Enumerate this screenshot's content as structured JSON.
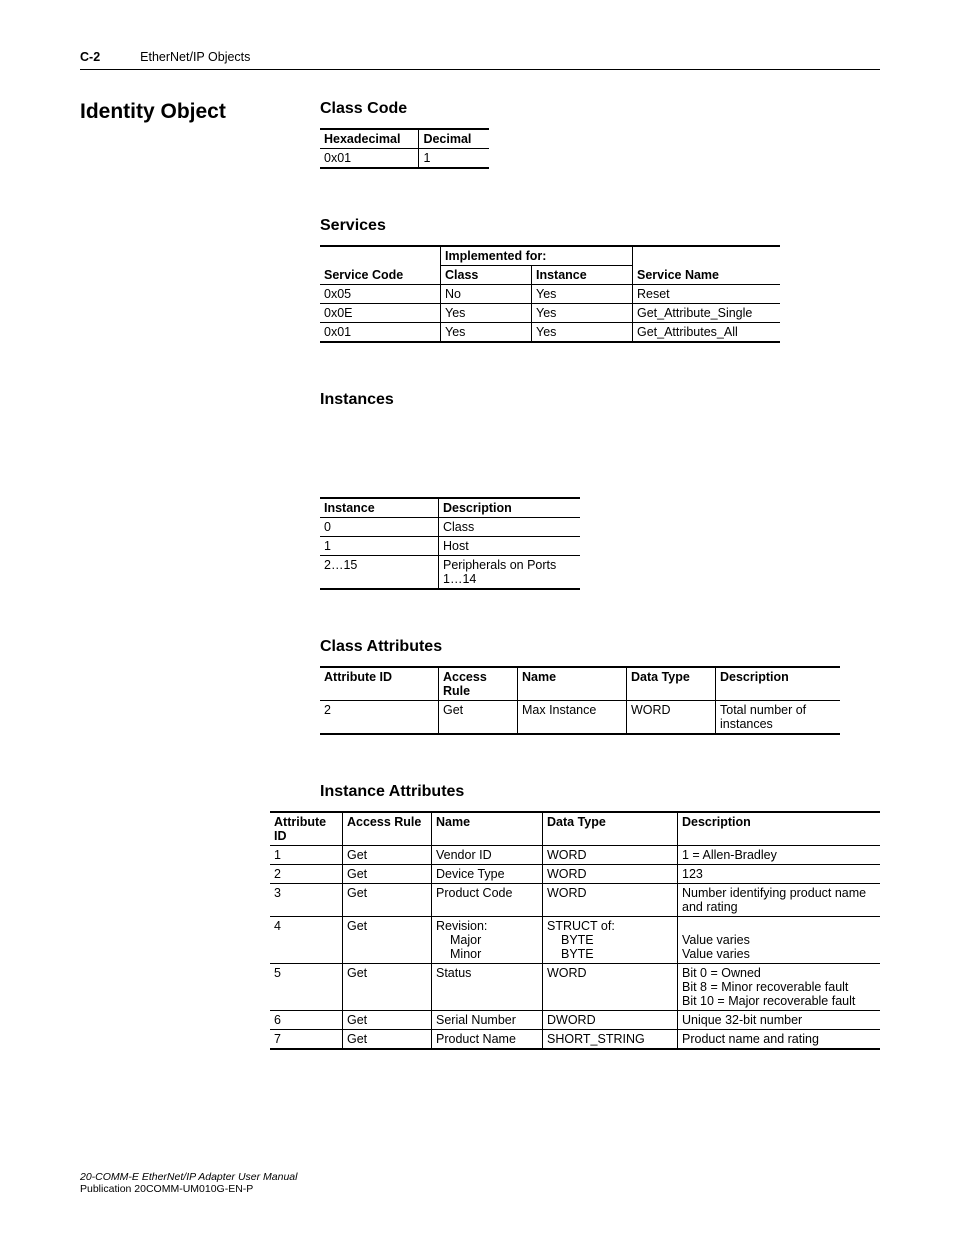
{
  "header": {
    "page_num": "C-2",
    "chapter": "EtherNet/IP Objects"
  },
  "main_title": "Identity Object",
  "sections": {
    "class_code": {
      "title": "Class Code",
      "headers": [
        "Hexadecimal",
        "Decimal"
      ],
      "row": [
        "0x01",
        "1"
      ]
    },
    "services": {
      "title": "Services",
      "group_header": "Implemented for:",
      "headers": [
        "Service Code",
        "Class",
        "Instance",
        "Service Name"
      ],
      "rows": [
        [
          "0x05",
          "No",
          "Yes",
          "Reset"
        ],
        [
          "0x0E",
          "Yes",
          "Yes",
          "Get_Attribute_Single"
        ],
        [
          "0x01",
          "Yes",
          "Yes",
          "Get_Attributes_All"
        ]
      ]
    },
    "instances": {
      "title": "Instances",
      "headers": [
        "Instance",
        "Description"
      ],
      "rows": [
        [
          "0",
          "Class"
        ],
        [
          "1",
          "Host"
        ],
        [
          "2…15",
          "Peripherals on Ports 1…14"
        ]
      ]
    },
    "class_attributes": {
      "title": "Class Attributes",
      "headers": [
        "Attribute ID",
        "Access Rule",
        "Name",
        "Data Type",
        "Description"
      ],
      "rows": [
        [
          "2",
          "Get",
          "Max Instance",
          "WORD",
          "Total number of instances"
        ]
      ]
    },
    "instance_attributes": {
      "title": "Instance Attributes",
      "headers": [
        "Attribute ID",
        "Access Rule",
        "Name",
        "Data Type",
        "Description"
      ],
      "rows": [
        {
          "id": "1",
          "ar": "Get",
          "name": "Vendor ID",
          "dt": "WORD",
          "desc": "1 = Allen-Bradley"
        },
        {
          "id": "2",
          "ar": "Get",
          "name": "Device Type",
          "dt": "WORD",
          "desc": "123"
        },
        {
          "id": "3",
          "ar": "Get",
          "name": "Product Code",
          "dt": "WORD",
          "desc": "Number identifying product name and rating"
        },
        {
          "id": "4",
          "ar": "Get",
          "name_lines": [
            "Revision:",
            "Major",
            "Minor"
          ],
          "dt_lines": [
            "STRUCT of:",
            "BYTE",
            "BYTE"
          ],
          "desc_lines": [
            "",
            "Value varies",
            "Value varies"
          ]
        },
        {
          "id": "5",
          "ar": "Get",
          "name": "Status",
          "dt": "WORD",
          "desc_lines": [
            "Bit 0 = Owned",
            "Bit 8 = Minor recoverable fault",
            "Bit 10 = Major recoverable fault"
          ]
        },
        {
          "id": "6",
          "ar": "Get",
          "name": "Serial Number",
          "dt": "DWORD",
          "desc": "Unique 32-bit number"
        },
        {
          "id": "7",
          "ar": "Get",
          "name": "Product Name",
          "dt": "SHORT_STRING",
          "desc": "Product name and rating"
        }
      ]
    }
  },
  "footer": {
    "title": "20-COMM-E EtherNet/IP Adapter User Manual",
    "pub": "Publication 20COMM-UM010G-EN-P"
  }
}
